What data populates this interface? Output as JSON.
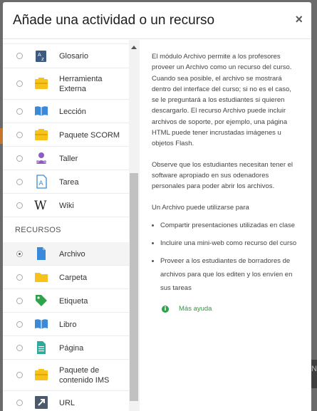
{
  "modal": {
    "title": "Añade una actividad o un recurso",
    "close_glyph": "×"
  },
  "activities": [
    {
      "label": "Glosario",
      "icon": "glossary-icon"
    },
    {
      "label": "Herramienta Externa",
      "icon": "external-tool-icon"
    },
    {
      "label": "Lección",
      "icon": "lesson-icon"
    },
    {
      "label": "Paquete SCORM",
      "icon": "scorm-package-icon"
    },
    {
      "label": "Taller",
      "icon": "workshop-icon"
    },
    {
      "label": "Tarea",
      "icon": "assignment-icon"
    },
    {
      "label": "Wiki",
      "icon": "wiki-icon"
    }
  ],
  "resources_section_label": "RECURSOS",
  "resources": [
    {
      "label": "Archivo",
      "icon": "file-icon",
      "selected": true
    },
    {
      "label": "Carpeta",
      "icon": "folder-icon"
    },
    {
      "label": "Etiqueta",
      "icon": "label-icon"
    },
    {
      "label": "Libro",
      "icon": "book-icon"
    },
    {
      "label": "Página",
      "icon": "page-icon"
    },
    {
      "label": "Paquete de contenido IMS",
      "icon": "ims-package-icon"
    },
    {
      "label": "URL",
      "icon": "url-icon"
    }
  ],
  "description": {
    "paragraph1": "El módulo Archivo permite a los profesores proveer un Archivo como un recurso del curso. Cuando sea posible, el archivo se mostrará dentro del interface del curso; si no es el caso, se le preguntará a los estudiantes si quieren descargarlo. El recurso Archivo puede incluir archivos de soporte, por ejemplo, una página HTML puede tener incrustadas imágenes u objetos Flash.",
    "paragraph2": "Observe que los estudiantes necesitan tener el software apropiado en sus odenadores personales para poder abrir los archivos.",
    "paragraph3": "Un Archivo puede utilizarse para",
    "bullets": [
      "Compartir presentaciones utilizadas en clase",
      "Incluire una mini-web como recurso del curso",
      "Proveer a los estudiantes de borradores de archivos para que los editen y los envíen en sus tareas"
    ],
    "help_label": "Más ayuda",
    "help_glyph": "i"
  },
  "colors": {
    "accent_green": "#31a24c",
    "icon_yellow": "#f7c21c",
    "icon_blue": "#3b8ad9",
    "icon_purple": "#8e5dbf"
  },
  "backdrop_text": "N"
}
